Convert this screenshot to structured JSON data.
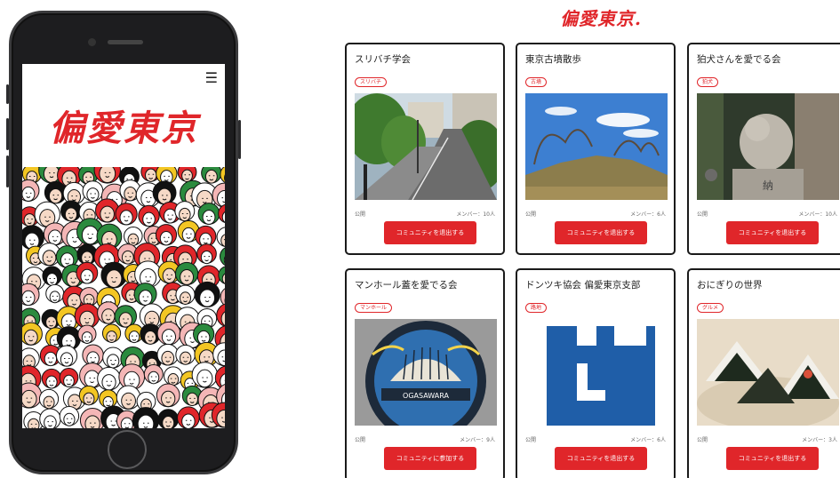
{
  "mobile": {
    "menu_icon": "hamburger-icon",
    "logo_text": "偏愛東京"
  },
  "header": {
    "logo_text": "偏愛東京."
  },
  "colors": {
    "brand_red": "#e0262a",
    "card_border": "#1a1a1a"
  },
  "communities": [
    {
      "title": "スリバチ学会",
      "tag": "スリバチ",
      "visibility": "公開",
      "members": "メンバー：10人",
      "action": "コミュニティを退出する"
    },
    {
      "title": "東京古墳散歩",
      "tag": "古墳",
      "visibility": "公開",
      "members": "メンバー：6人",
      "action": "コミュニティを退出する"
    },
    {
      "title": "狛犬さんを愛でる会",
      "tag": "狛犬",
      "visibility": "公開",
      "members": "メンバー：10人",
      "action": "コミュニティを退出する"
    },
    {
      "title": "マンホール蓋を愛でる会",
      "tag": "マンホール",
      "visibility": "公開",
      "members": "メンバー：9人",
      "action": "コミュニティに参加する"
    },
    {
      "title": "ドンツキ協会 偏愛東京支部",
      "tag": "路地",
      "visibility": "公開",
      "members": "メンバー：6人",
      "action": "コミュニティを退出する"
    },
    {
      "title": "おにぎりの世界",
      "tag": "グルメ",
      "visibility": "公開",
      "members": "メンバー：3人",
      "action": "コミュニティを退出する"
    }
  ]
}
